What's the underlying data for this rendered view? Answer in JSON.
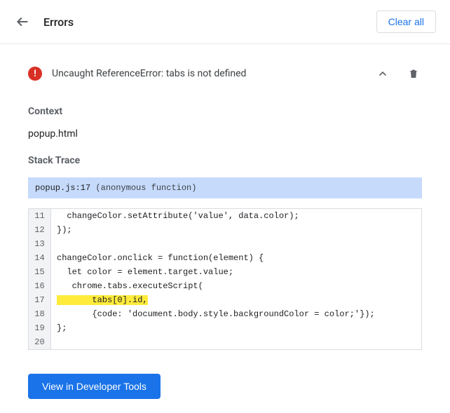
{
  "header": {
    "title": "Errors",
    "clear_label": "Clear all"
  },
  "error": {
    "message": "Uncaught ReferenceError: tabs is not defined",
    "context_label": "Context",
    "context_value": "popup.html",
    "stack_trace_label": "Stack Trace",
    "stack_location": "popup.js:17",
    "stack_function": "(anonymous function)"
  },
  "code": {
    "lines": [
      {
        "num": "11",
        "text": "  changeColor.setAttribute('value', data.color);",
        "highlight": ""
      },
      {
        "num": "12",
        "text": "});",
        "highlight": ""
      },
      {
        "num": "13",
        "text": "",
        "highlight": ""
      },
      {
        "num": "14",
        "text": "changeColor.onclick = function(element) {",
        "highlight": ""
      },
      {
        "num": "15",
        "text": "  let color = element.target.value;",
        "highlight": ""
      },
      {
        "num": "16",
        "text": "   chrome.tabs.executeScript(",
        "highlight": ""
      },
      {
        "num": "17",
        "text": "",
        "highlight": "       tabs[0].id,"
      },
      {
        "num": "18",
        "text": "       {code: 'document.body.style.backgroundColor = color;'});",
        "highlight": ""
      },
      {
        "num": "19",
        "text": "};",
        "highlight": ""
      },
      {
        "num": "20",
        "text": "",
        "highlight": ""
      }
    ]
  },
  "footer": {
    "view_label": "View in Developer Tools"
  }
}
